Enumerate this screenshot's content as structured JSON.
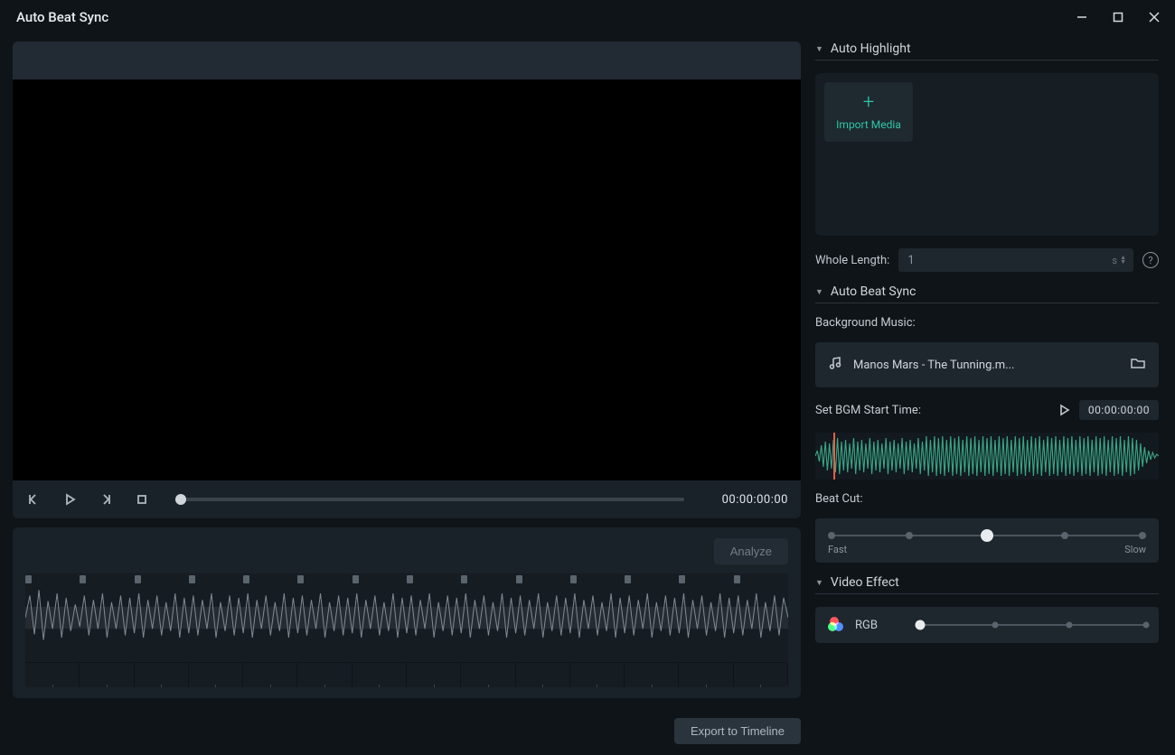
{
  "window": {
    "title": "Auto Beat Sync"
  },
  "player": {
    "timecode": "00:00:00:00"
  },
  "timeline": {
    "analyze": "Analyze",
    "export": "Export to Timeline"
  },
  "sections": {
    "auto_highlight": "Auto Highlight",
    "auto_beat_sync": "Auto Beat Sync",
    "video_effect": "Video Effect"
  },
  "import": {
    "label": "Import Media"
  },
  "whole_length": {
    "label": "Whole Length:",
    "value": "1",
    "suffix": "s"
  },
  "bgm": {
    "label": "Background Music:",
    "file": "Manos Mars - The Tunning.m...",
    "start_label": "Set BGM Start Time:",
    "start_value": "00:00:00:00"
  },
  "beat_cut": {
    "label": "Beat Cut:",
    "fast": "Fast",
    "slow": "Slow"
  },
  "effect": {
    "name": "RGB"
  }
}
